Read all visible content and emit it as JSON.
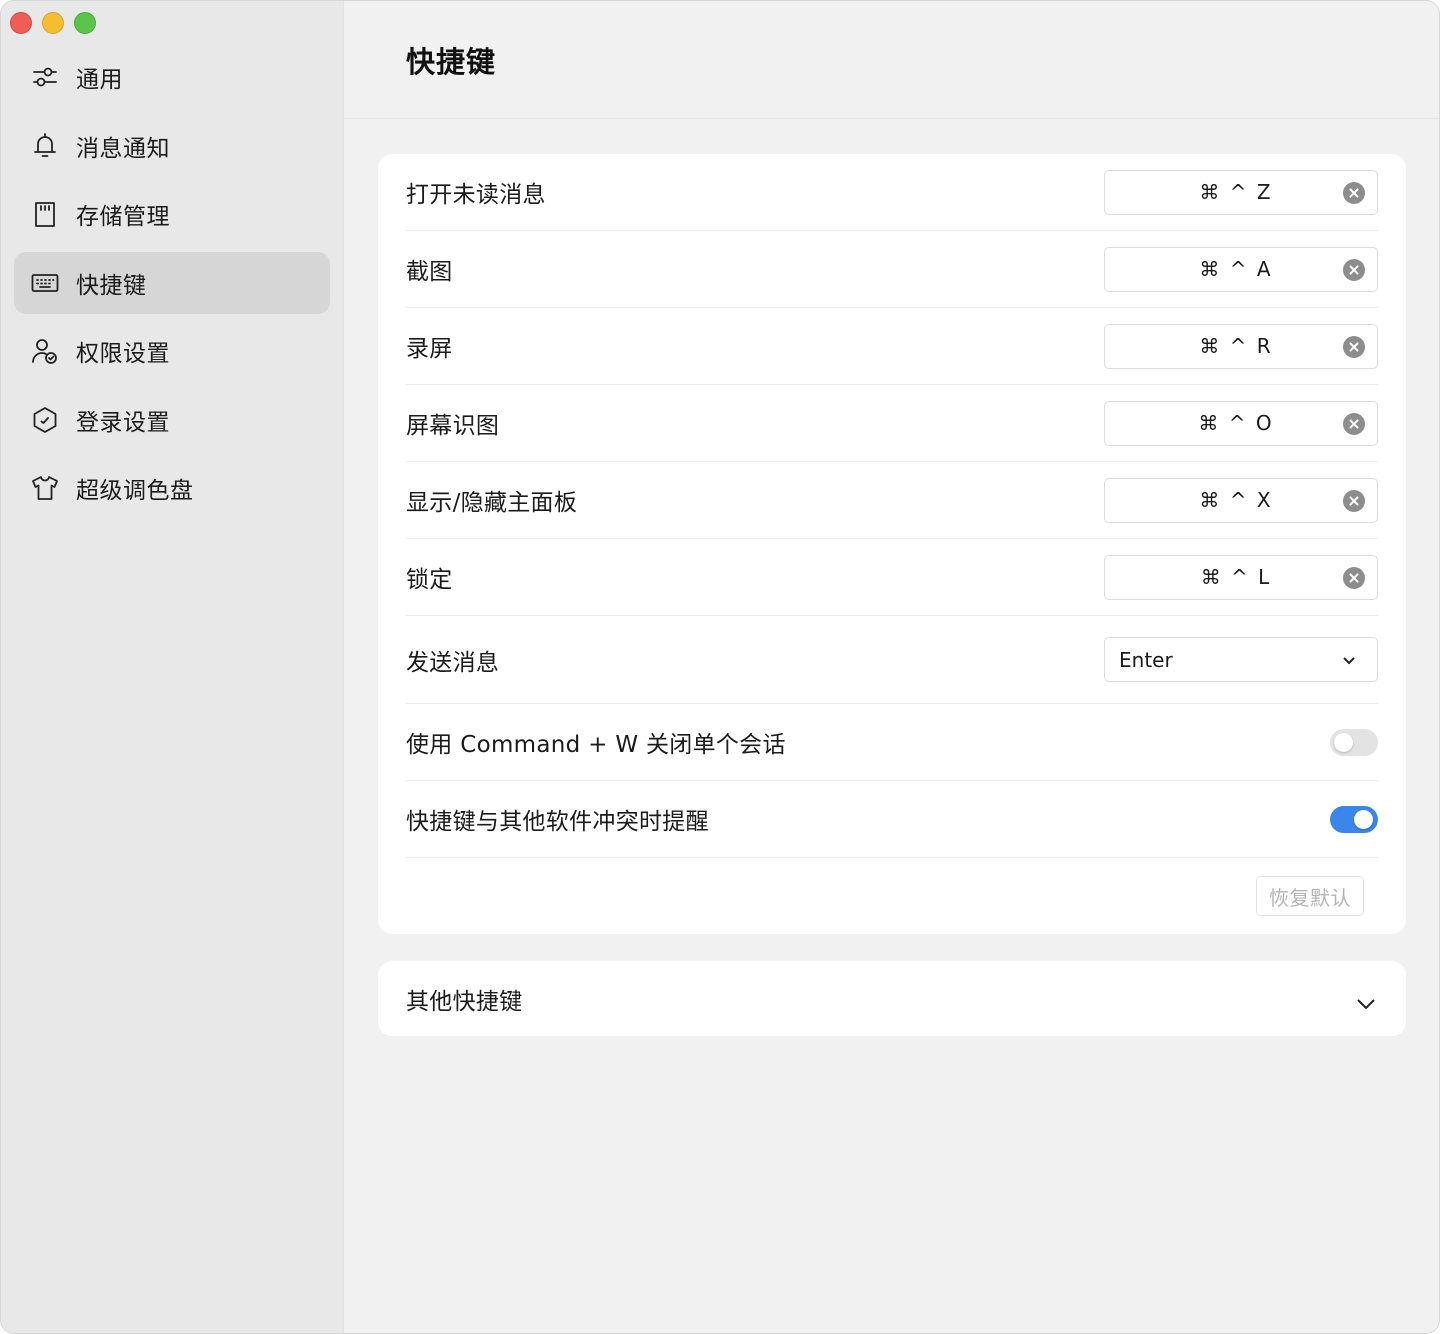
{
  "window": {
    "traffic_lights": {
      "close": "#ee5d56",
      "minimize": "#f5bd34",
      "maximize": "#5ac54a"
    }
  },
  "sidebar": {
    "items": [
      {
        "label": "通用",
        "icon": "sliders-icon",
        "active": false
      },
      {
        "label": "消息通知",
        "icon": "bell-icon",
        "active": false
      },
      {
        "label": "存储管理",
        "icon": "sd-card-icon",
        "active": false
      },
      {
        "label": "快捷键",
        "icon": "keyboard-icon",
        "active": true
      },
      {
        "label": "权限设置",
        "icon": "user-shield-icon",
        "active": false
      },
      {
        "label": "登录设置",
        "icon": "hexagon-check-icon",
        "active": false
      },
      {
        "label": "超级调色盘",
        "icon": "tshirt-icon",
        "active": false
      }
    ]
  },
  "main": {
    "title": "快捷键",
    "shortcuts": [
      {
        "label": "打开未读消息",
        "keys": "⌘ ^ Z"
      },
      {
        "label": "截图",
        "keys": "⌘ ^ A"
      },
      {
        "label": "录屏",
        "keys": "⌘ ^ R"
      },
      {
        "label": "屏幕识图",
        "keys": "⌘ ^ O"
      },
      {
        "label": "显示/隐藏主面板",
        "keys": "⌘ ^ X"
      },
      {
        "label": "锁定",
        "keys": "⌘ ^ L"
      }
    ],
    "send_message": {
      "label": "发送消息",
      "value": "Enter"
    },
    "toggles": [
      {
        "label": "使用 Command + W 关闭单个会话",
        "on": false
      },
      {
        "label": "快捷键与其他软件冲突时提醒",
        "on": true
      }
    ],
    "restore_label": "恢复默认",
    "other_shortcuts_label": "其他快捷键",
    "accent_color": "#3b86ea"
  }
}
